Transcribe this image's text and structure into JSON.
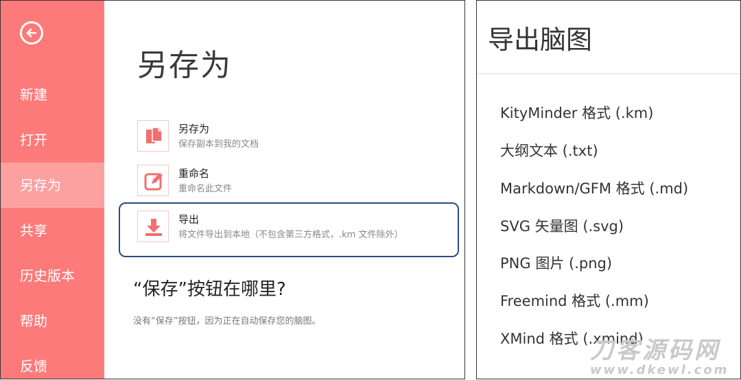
{
  "sidebar": {
    "items": [
      {
        "label": "新建"
      },
      {
        "label": "打开"
      },
      {
        "label": "另存为",
        "active": true
      },
      {
        "label": "共享"
      },
      {
        "label": "历史版本"
      },
      {
        "label": "帮助"
      },
      {
        "label": "反馈"
      }
    ]
  },
  "main": {
    "title": "另存为",
    "options": [
      {
        "title": "另存为",
        "desc": "保存副本到我的文档",
        "icon": "copy-icon"
      },
      {
        "title": "重命名",
        "desc": "重命名此文件",
        "icon": "edit-icon"
      },
      {
        "title": "导出",
        "desc": "将文件导出到本地（不包含第三方格式，.km 文件除外）",
        "icon": "download-icon"
      }
    ],
    "where_title": "“保存”按钮在哪里?",
    "where_desc": "没有“保存”按钮，因为正在自动保存您的脑图。"
  },
  "export_panel": {
    "title": "导出脑图",
    "formats": [
      {
        "label": "KityMinder 格式 (.km)"
      },
      {
        "label": "大纲文本 (.txt)"
      },
      {
        "label": "Markdown/GFM 格式 (.md)"
      },
      {
        "label": "SVG 矢量图 (.svg)"
      },
      {
        "label": "PNG 图片 (.png)"
      },
      {
        "label": "Freemind 格式 (.mm)"
      },
      {
        "label": "XMind 格式 (.xmind)"
      }
    ]
  },
  "watermark": {
    "main": "刀客源码网",
    "url": "www.dkewl.com"
  },
  "colors": {
    "sidebar_bg": "#fd7a7a",
    "sidebar_active": "#fda0a0",
    "icon_accent": "#f26f6f",
    "highlight_border": "#2c4a80"
  }
}
